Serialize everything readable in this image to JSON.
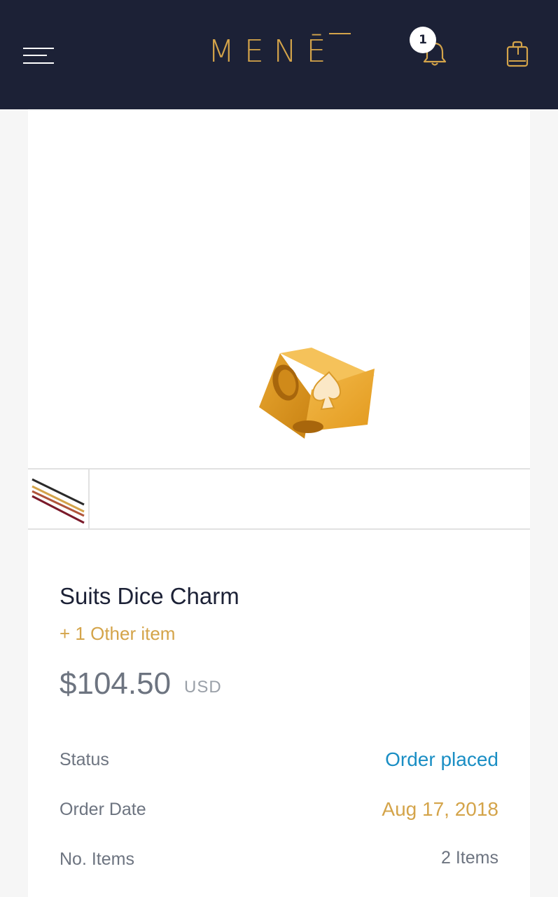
{
  "header": {
    "brand": "MENĒ",
    "notification_count": "1",
    "colors": {
      "background": "#1c2136",
      "accent": "#d4a44a"
    },
    "icons": [
      "menu-icon",
      "bell-icon",
      "shopping-bag-icon"
    ]
  },
  "product": {
    "image": "gold-suits-dice-charm",
    "name": "Suits Dice Charm",
    "other_items": "+ 1 Other item",
    "price": "$104.50",
    "currency": "USD"
  },
  "order": {
    "rows": [
      {
        "label": "Status",
        "value": "Order placed",
        "value_color": "#1a8ec4"
      },
      {
        "label": "Order Date",
        "value": "Aug 17, 2018",
        "value_color": "#d4a44a"
      },
      {
        "label": "No. Items",
        "value": "2 Items",
        "value_color": "#6d7480"
      }
    ]
  }
}
